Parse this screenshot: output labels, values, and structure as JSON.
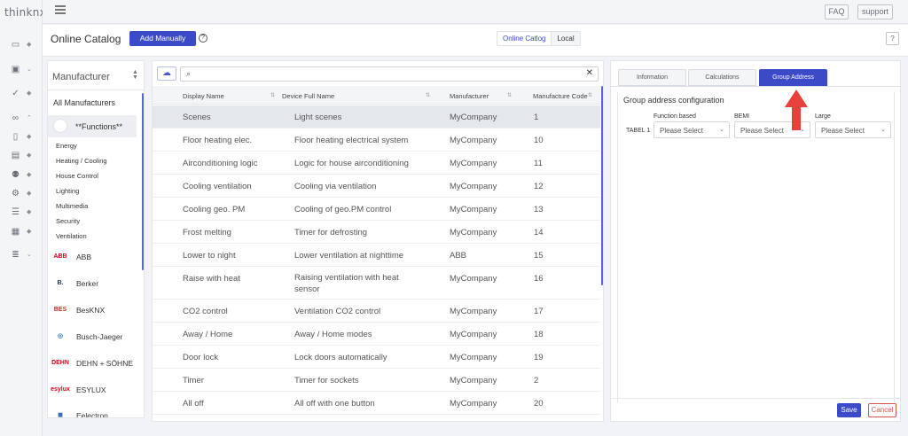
{
  "app": {
    "logo_text": "thinknx"
  },
  "topbar": {
    "faq_label": "FAQ",
    "support_label": "support"
  },
  "header": {
    "title": "Online Catalog",
    "add_manually_label": "Add Manually",
    "help_glyph": "?",
    "toggle_online": "Online Catlog",
    "toggle_local": "Local",
    "corner_help": "?"
  },
  "rail": {
    "items": [
      {
        "icon": "dashboard-icon",
        "glyph": "▭",
        "caret": "◆"
      },
      {
        "icon": "user-box-icon",
        "glyph": "▣",
        "caret": "⌄"
      },
      {
        "icon": "check-icon",
        "glyph": "✓",
        "caret": "◆"
      },
      {
        "icon": "link-icon",
        "glyph": "∞",
        "caret": "⌃"
      },
      {
        "icon": "book-icon",
        "glyph": "▯",
        "caret": "◆"
      },
      {
        "icon": "document-icon",
        "glyph": "▤",
        "caret": "◆"
      },
      {
        "icon": "users-icon",
        "glyph": "⚉",
        "caret": "◆"
      },
      {
        "icon": "gear-icon",
        "glyph": "⚙",
        "caret": "◆"
      },
      {
        "icon": "list-icon",
        "glyph": "☰",
        "caret": "◆"
      },
      {
        "icon": "gallery-icon",
        "glyph": "▦",
        "caret": "◆"
      },
      {
        "icon": "stack-icon",
        "glyph": "≣",
        "caret": "⌄"
      }
    ]
  },
  "manufacturers": {
    "label": "Manufacturer",
    "all_label": "All Manufacturers",
    "functions_label": "**Functions**",
    "subcategories": [
      "Energy",
      "Heating / Cooling",
      "House Control",
      "Lighting",
      "Multimedia",
      "Security",
      "Ventilation"
    ],
    "brands": [
      {
        "name": "ABB",
        "logo_text": "ABB",
        "color": "#e2001a"
      },
      {
        "name": "Berker",
        "logo_text": "B.",
        "color": "#1d3a6b"
      },
      {
        "name": "BesKNX",
        "logo_text": "BES",
        "color": "#c0392b"
      },
      {
        "name": "Busch-Jaeger",
        "logo_text": "◎",
        "color": "#2a7fd4"
      },
      {
        "name": "DEHN + SÖHNE",
        "logo_text": "DEHN",
        "color": "#d0021b"
      },
      {
        "name": "ESYLUX",
        "logo_text": "esylux",
        "color": "#d0021b"
      },
      {
        "name": "Eelectron",
        "logo_text": "◼",
        "color": "#3b6fb6"
      }
    ]
  },
  "table": {
    "search_placeholder": "",
    "clear_glyph": "✕",
    "columns": [
      "Display Name",
      "Device Full Name",
      "Manufacturer",
      "Manufacture Code"
    ],
    "rows": [
      {
        "display": "Scenes",
        "full": "Light scenes",
        "mfr": "MyCompany",
        "code": "1"
      },
      {
        "display": "Floor heating elec.",
        "full": "Floor heating electrical system",
        "mfr": "MyCompany",
        "code": "10"
      },
      {
        "display": "Airconditioning logic",
        "full": "Logic for house airconditioning",
        "mfr": "MyCompany",
        "code": "11"
      },
      {
        "display": "Cooling ventilation",
        "full": "Cooling via ventilation",
        "mfr": "MyCompany",
        "code": "12"
      },
      {
        "display": "Cooling geo. PM",
        "full": "Cooling of geo.PM control",
        "mfr": "MyCompany",
        "code": "13"
      },
      {
        "display": "Frost melting",
        "full": "Timer for defrosting",
        "mfr": "MyCompany",
        "code": "14"
      },
      {
        "display": "Lower to night",
        "full": "Lower ventilation at nighttime",
        "mfr": "ABB",
        "code": "15"
      },
      {
        "display": "Raise with heat",
        "full": "Raising ventilation with heat sensor",
        "mfr": "MyCompany",
        "code": "16"
      },
      {
        "display": "CO2 control",
        "full": "Ventilation CO2 control",
        "mfr": "MyCompany",
        "code": "17"
      },
      {
        "display": "Away / Home",
        "full": "Away / Home modes",
        "mfr": "MyCompany",
        "code": "18"
      },
      {
        "display": "Door lock",
        "full": "Lock doors automatically",
        "mfr": "MyCompany",
        "code": "19"
      },
      {
        "display": "Timer",
        "full": "Timer for sockets",
        "mfr": "MyCompany",
        "code": "2"
      },
      {
        "display": "All off",
        "full": "All off with one button",
        "mfr": "MyCompany",
        "code": "20"
      }
    ]
  },
  "right": {
    "tabs": [
      "Information",
      "Calculations",
      "Group Address"
    ],
    "active_tab": "Group Address",
    "ga_title": "Group address configuration",
    "ga_columns": [
      "Function based",
      "BEMI",
      "Large"
    ],
    "ga_row_label": "TABEL 1",
    "select_value": "Please Select",
    "save_label": "Save",
    "cancel_label": "Cancel",
    "arrow_color": "#e8403a"
  }
}
